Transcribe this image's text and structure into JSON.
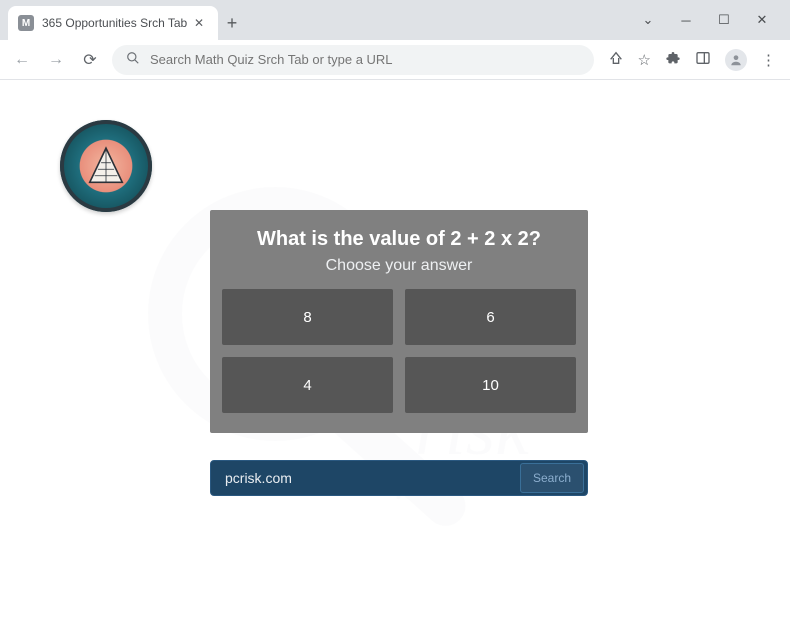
{
  "browser": {
    "tab": {
      "favicon_letter": "M",
      "title": "365 Opportunities Srch Tab"
    },
    "omnibox_placeholder": "Search Math Quiz Srch Tab or type a URL"
  },
  "quiz": {
    "question": "What is the value of 2 + 2 x 2?",
    "subtitle": "Choose your answer",
    "answers": [
      "8",
      "6",
      "4",
      "10"
    ]
  },
  "search": {
    "value": "pcrisk.com",
    "button_label": "Search"
  }
}
